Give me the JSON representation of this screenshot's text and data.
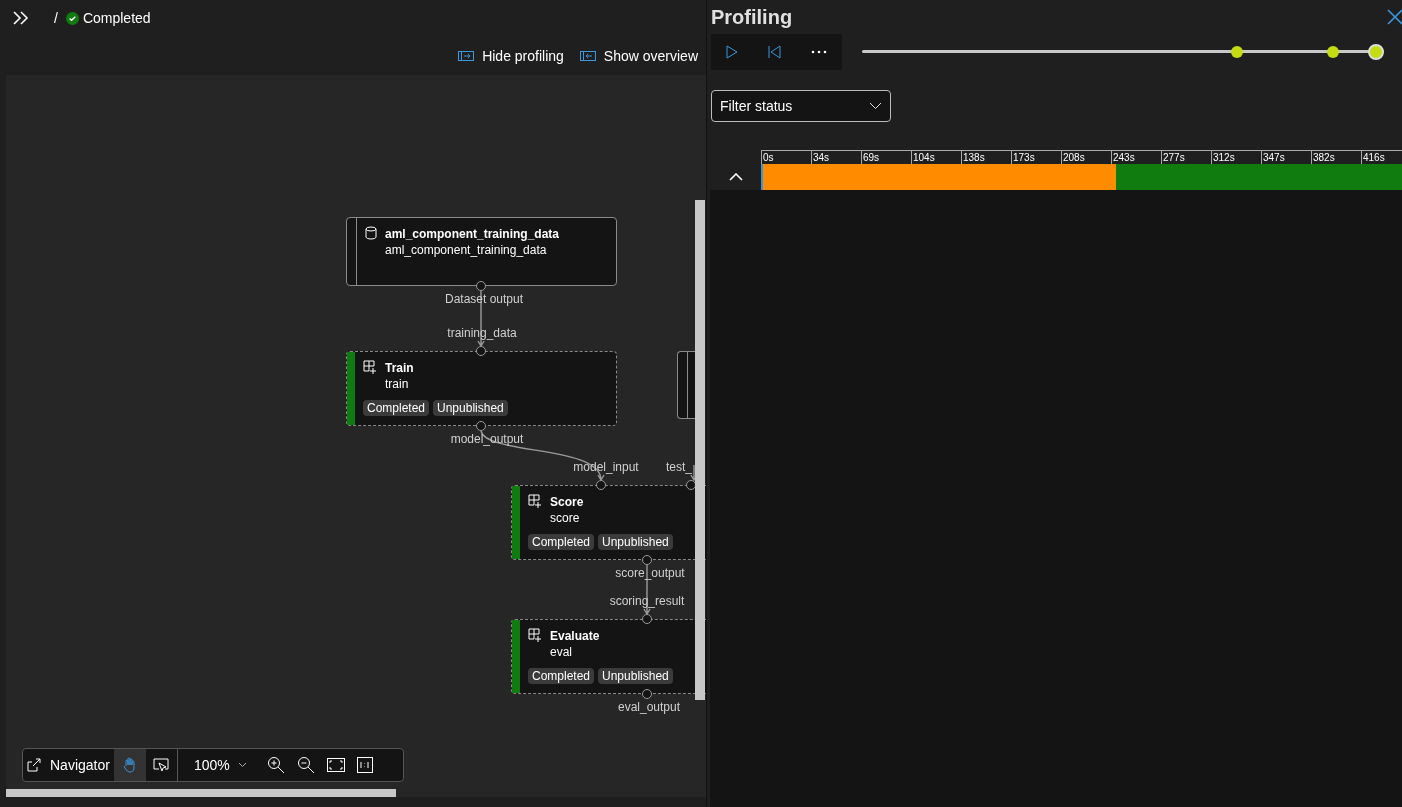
{
  "header": {
    "separator": "/",
    "status": {
      "label": "Completed",
      "kind": "success"
    }
  },
  "toolbar": [
    {
      "label": "Hide profiling",
      "kind": "hide"
    },
    {
      "label": "Show overview",
      "kind": "overview"
    }
  ],
  "canvas": {
    "nodes": [
      {
        "kind": "dataset",
        "title": "aml_component_training_data",
        "subtitle": "aml_component_training_data"
      },
      {
        "kind": "component",
        "title": "Train",
        "subtitle": "train",
        "status": "Completed",
        "completed": true,
        "badge": "Unpublished"
      },
      {
        "kind": "partial"
      },
      {
        "kind": "component",
        "title": "Score",
        "subtitle": "score",
        "status": "Completed",
        "completed": true,
        "badge": "Unpublished"
      },
      {
        "kind": "component",
        "title": "Evaluate",
        "subtitle": "eval",
        "status": "Completed",
        "completed": true,
        "badge": "Unpublished"
      }
    ],
    "port_labels": [
      "Dataset output",
      "training_data",
      "model_output",
      "model_input",
      "test_",
      "score_output",
      "scoring_result",
      "eval_output"
    ]
  },
  "navigator": {
    "label": "Navigator",
    "zoom": "100%",
    "pan_selected": true
  },
  "profiling": {
    "title": "Profiling",
    "slider": {
      "level": 1,
      "markers": [
        {
          "level": 0.718
        },
        {
          "level": 0.902
        }
      ]
    },
    "filter": {
      "placeholder": "Filter status"
    },
    "timeline": {
      "expanded": true,
      "ticks": [
        "0s",
        "34s",
        "69s",
        "104s",
        "138s",
        "173s",
        "208s",
        "243s",
        "277s",
        "312s",
        "347s",
        "382s",
        "416s"
      ],
      "segments": [
        {
          "color": "#ff8c00",
          "level": 0.545
        },
        {
          "color": "#107c10",
          "level": 0.455
        }
      ]
    }
  }
}
